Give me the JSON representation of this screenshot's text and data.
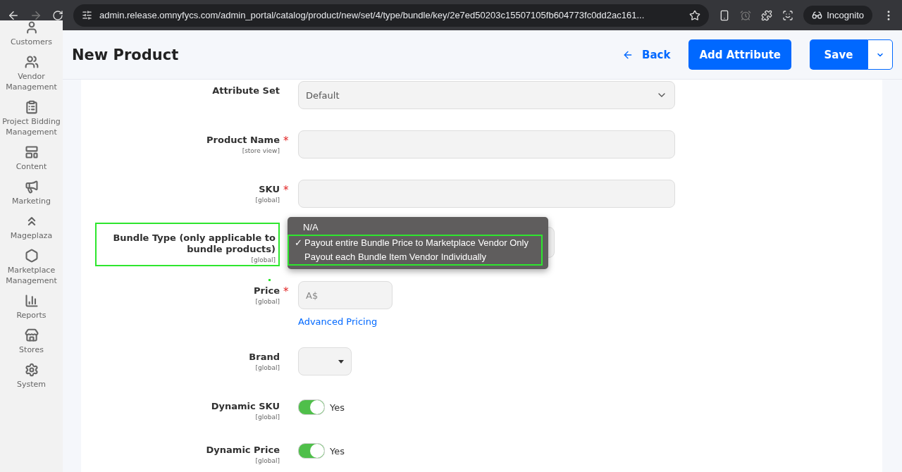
{
  "browser": {
    "url": "admin.release.omnyfycs.com/admin_portal/catalog/product/new/set/4/type/bundle/key/2e7ed50203c15507105fb604773fc0dd2ac161...",
    "profile": "Incognito"
  },
  "sidebar": {
    "items": [
      {
        "label": "Customers",
        "kind": "person"
      },
      {
        "label": "Vendor Management",
        "kind": "people"
      },
      {
        "label": "Project Bidding Management",
        "kind": "clipboard"
      },
      {
        "label": "Content",
        "kind": "layout"
      },
      {
        "label": "Marketing",
        "kind": "megaphone"
      },
      {
        "label": "Mageplaza",
        "kind": "chevron"
      },
      {
        "label": "Marketplace Management",
        "kind": "hexagon"
      },
      {
        "label": "Reports",
        "kind": "bars"
      },
      {
        "label": "Stores",
        "kind": "store"
      },
      {
        "label": "System",
        "kind": "gear"
      }
    ]
  },
  "header": {
    "title": "New Product",
    "back": "Back",
    "add_attribute": "Add Attribute",
    "save": "Save"
  },
  "form": {
    "fields": [
      {
        "label": "Attribute Set",
        "kind": "select",
        "value": "Default",
        "highlighted": false
      },
      {
        "label": "Product Name",
        "scope": "[store view]",
        "kind": "text",
        "required_mark": "*",
        "highlighted": false
      },
      {
        "label": "SKU",
        "scope": "[global]",
        "kind": "text",
        "required_mark": "*",
        "highlighted": false
      },
      {
        "label": "Bundle Type (only applicable to bundle products)",
        "scope": "[global]",
        "kind": "menu",
        "highlighted": true,
        "check_mark": "✓",
        "options": [
          {
            "label": "N/A",
            "selected": false,
            "highlighted": false
          },
          {
            "label": "Payout entire Bundle Price to Marketplace Vendor Only",
            "selected": true,
            "highlighted": true
          },
          {
            "label": "Payout each Bundle Item Vendor Individually",
            "selected": false,
            "highlighted": true
          }
        ]
      },
      {
        "label": "Price",
        "scope": "[global]",
        "kind": "price",
        "placeholder": "A$",
        "required_mark": "*",
        "highlighted": false,
        "link": "Advanced Pricing"
      },
      {
        "label": "Brand",
        "scope": "[global]",
        "kind": "dropdown",
        "highlighted": false
      },
      {
        "label": "Dynamic SKU",
        "scope": "[global]",
        "kind": "toggle",
        "on": true,
        "value": "Yes",
        "highlighted": false
      },
      {
        "label": "Dynamic Price",
        "scope": "[global]",
        "kind": "toggle",
        "on": true,
        "value": "Yes",
        "highlighted": false
      }
    ]
  }
}
